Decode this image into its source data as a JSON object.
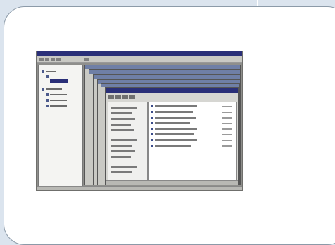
{
  "frame": {
    "card_color": "#ffffff",
    "border_color": "#8c9aa8",
    "background_color": "#dbe4ee"
  },
  "screenshot": {
    "description_icon": "explorer-style-nested-windows",
    "titlebar_color": "#2a2f78"
  }
}
